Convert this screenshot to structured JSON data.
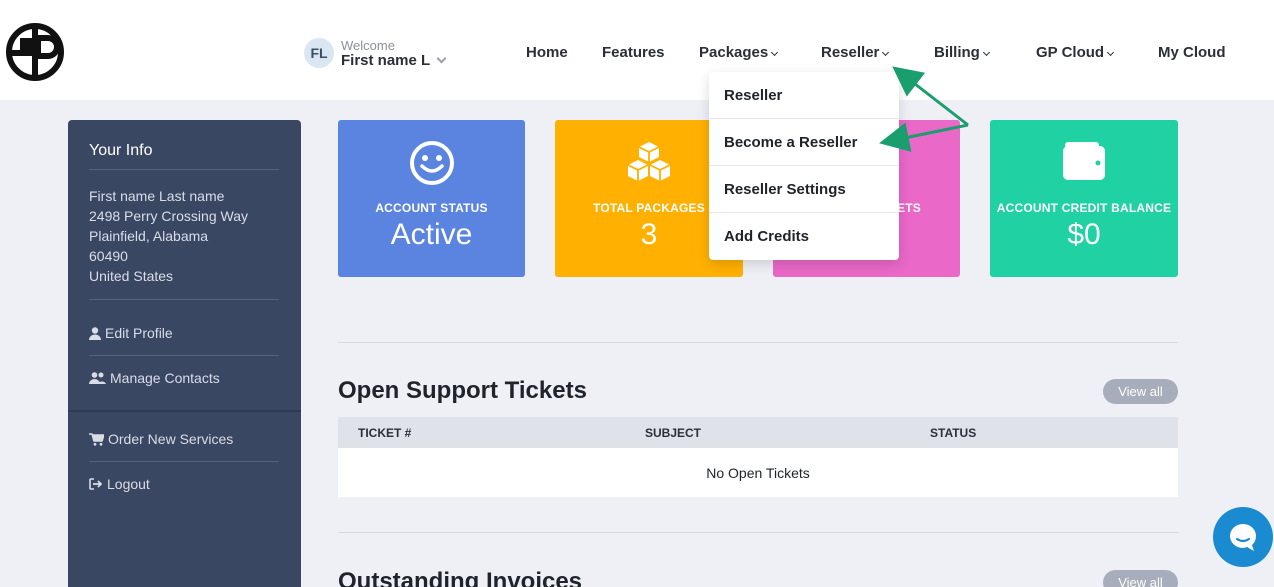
{
  "header": {
    "logo_name": "logo",
    "welcome_label": "Welcome",
    "avatar_initials": "FL",
    "user_name": "First name L"
  },
  "nav": {
    "home": "Home",
    "features": "Features",
    "packages": "Packages",
    "reseller": "Reseller",
    "billing": "Billing",
    "gp_cloud": "GP Cloud",
    "my_cloud": "My Cloud"
  },
  "reseller_menu": {
    "items": [
      "Reseller",
      "Become a Reseller",
      "Reseller Settings",
      "Add Credits"
    ]
  },
  "sidebar": {
    "title": "Your Info",
    "address": [
      "First name Last name",
      "2498 Perry Crossing Way",
      "Plainfield, Alabama",
      "60490",
      "United States"
    ],
    "edit_profile": "Edit Profile",
    "manage_contacts": "Manage Contacts",
    "order_services": "Order New Services",
    "logout": "Logout"
  },
  "cards": [
    {
      "label": "ACCOUNT STATUS",
      "value": "Active",
      "color": "#5b84e0",
      "icon": "smiley-icon"
    },
    {
      "label": "TOTAL PACKAGES",
      "value": "3",
      "color": "#ffb000",
      "icon": "cubes-icon"
    },
    {
      "label": "ETS",
      "value": "",
      "color": "#e968c8",
      "icon": "ticket-icon"
    },
    {
      "label": "ACCOUNT CREDIT BALANCE",
      "value": "$0",
      "color": "#20d2a3",
      "icon": "wallet-icon"
    }
  ],
  "tickets": {
    "title": "Open Support Tickets",
    "view_all": "View all",
    "columns": [
      "TICKET #",
      "SUBJECT",
      "STATUS"
    ],
    "empty_message": "No Open Tickets"
  },
  "invoices": {
    "title": "Outstanding Invoices",
    "view_all": "View all"
  },
  "colors": {
    "sidebar": "#3a4763",
    "annotation_arrow": "#1a9e6e",
    "chat": "#1a8bd0"
  }
}
